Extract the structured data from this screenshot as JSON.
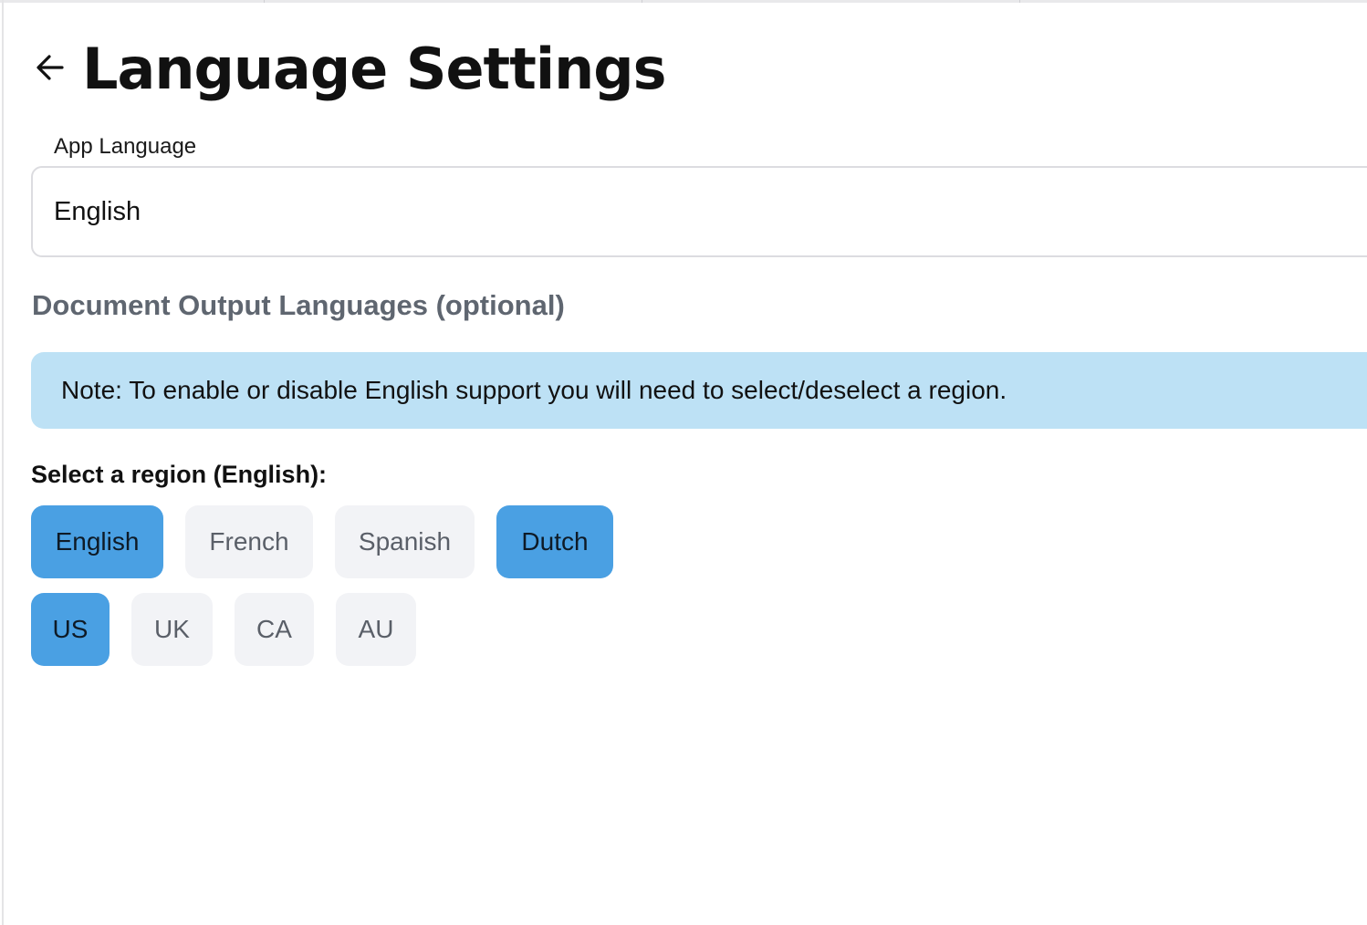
{
  "header": {
    "back_icon": "arrow-left-icon",
    "title": "Language Settings"
  },
  "app_language": {
    "label": "App Language",
    "value": "English"
  },
  "document_output": {
    "heading": "Document Output Languages (optional)",
    "note": "Note: To enable or disable English support you will need to select/deselect a region."
  },
  "region_selector": {
    "label": "Select a region (English):",
    "languages": [
      {
        "label": "English",
        "selected": true
      },
      {
        "label": "French",
        "selected": false
      },
      {
        "label": "Spanish",
        "selected": false
      },
      {
        "label": "Dutch",
        "selected": true
      }
    ],
    "regions": [
      {
        "label": "US",
        "selected": true
      },
      {
        "label": "UK",
        "selected": false
      },
      {
        "label": "CA",
        "selected": false
      },
      {
        "label": "AU",
        "selected": false
      }
    ]
  },
  "colors": {
    "selected_chip": "#4aa0e3",
    "unselected_chip": "#f2f3f6",
    "note_background": "#bde1f5",
    "section_heading": "#5f6670"
  }
}
